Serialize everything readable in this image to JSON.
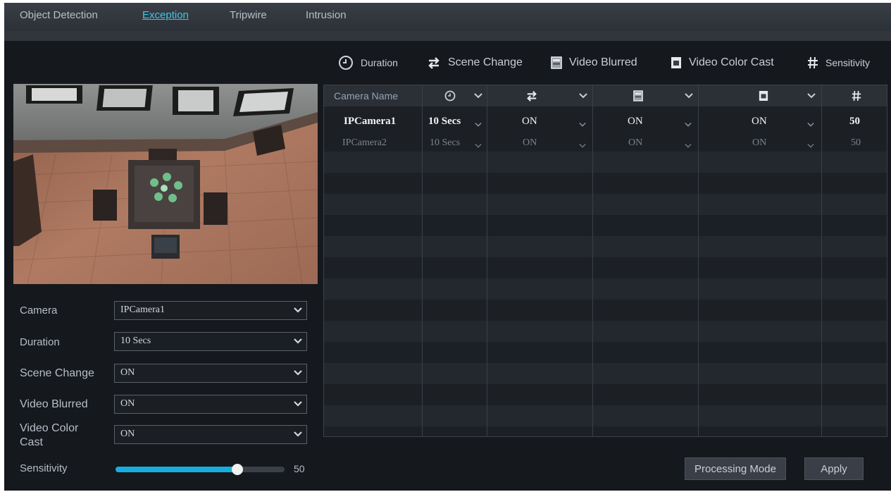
{
  "tabs": [
    {
      "label": "Object Detection",
      "active": false
    },
    {
      "label": "Exception",
      "active": true
    },
    {
      "label": "Tripwire",
      "active": false
    },
    {
      "label": "Intrusion",
      "active": false
    }
  ],
  "legend": {
    "duration": "Duration",
    "scene_change": "Scene Change",
    "video_blurred": "Video Blurred",
    "video_color_cast": "Video Color Cast",
    "sensitivity": "Sensitivity"
  },
  "table": {
    "camera_name_header": "Camera Name",
    "rows": [
      {
        "camera": "IPCamera1",
        "duration": "10 Secs",
        "scene_change": "ON",
        "video_blurred": "ON",
        "video_color_cast": "ON",
        "sensitivity": "50"
      },
      {
        "camera": "IPCamera2",
        "duration": "10 Secs",
        "scene_change": "ON",
        "video_blurred": "ON",
        "video_color_cast": "ON",
        "sensitivity": "50"
      }
    ]
  },
  "form": {
    "camera_label": "Camera",
    "camera_value": "IPCamera1",
    "duration_label": "Duration",
    "duration_value": "10 Secs",
    "scene_change_label": "Scene Change",
    "scene_change_value": "ON",
    "video_blurred_label": "Video Blurred",
    "video_blurred_value": "ON",
    "video_color_cast_label_1": "Video Color",
    "video_color_cast_label_2": "Cast",
    "video_color_cast_value": "ON",
    "sensitivity_label": "Sensitivity",
    "sensitivity_value": "50",
    "sensitivity_fraction": 0.72
  },
  "buttons": {
    "processing_mode": "Processing Mode",
    "apply": "Apply"
  },
  "colors": {
    "accent": "#3fc6e6",
    "slider_fill": "#17aede"
  },
  "icons": {
    "duration": "clock-icon",
    "scene_change": "swap-arrows-icon",
    "video_blurred": "blurred-screen-icon",
    "video_color_cast": "color-cast-icon",
    "sensitivity": "hash-icon",
    "dropdown": "chevron-down-icon"
  }
}
